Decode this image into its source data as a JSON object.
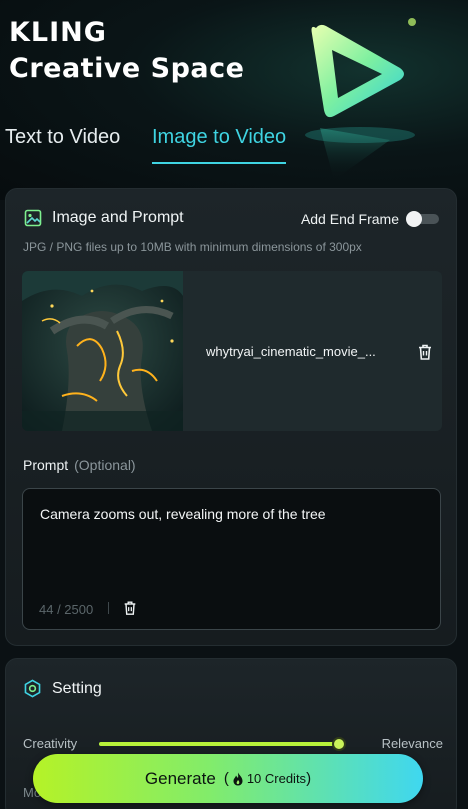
{
  "brand": {
    "line1": "KLING",
    "line2": "Creative Space"
  },
  "tabs": [
    {
      "label": "Text to Video",
      "active": false
    },
    {
      "label": "Image to Video",
      "active": true
    }
  ],
  "image_prompt": {
    "title": "Image and Prompt",
    "end_frame_label": "Add End Frame",
    "end_frame_enabled": false,
    "hint": "JPG / PNG files up to 10MB with minimum dimensions of 300px",
    "file_name": "whytryai_cinematic_movie_..."
  },
  "prompt": {
    "label": "Prompt",
    "optional": "(Optional)",
    "value": "Camera zooms out, revealing more of the tree",
    "counter": "44 / 2500"
  },
  "settings": {
    "title": "Setting",
    "slider_left": "Creativity",
    "slider_right": "Relevance",
    "slider_value": 1.0,
    "next_label_peek": "Mo"
  },
  "generate": {
    "label": "Generate",
    "paren_open": "(",
    "credits": "10 Credits",
    "paren_close": ")"
  },
  "colors": {
    "accent": "#3fd4e2",
    "slider": "#b8f23a",
    "generate_start": "#b5f227",
    "generate_end": "#3fd7f0"
  },
  "icons": {
    "image": "image-icon",
    "delete": "trash-icon",
    "settings": "hexagon-settings-icon",
    "credits": "flame-icon"
  }
}
